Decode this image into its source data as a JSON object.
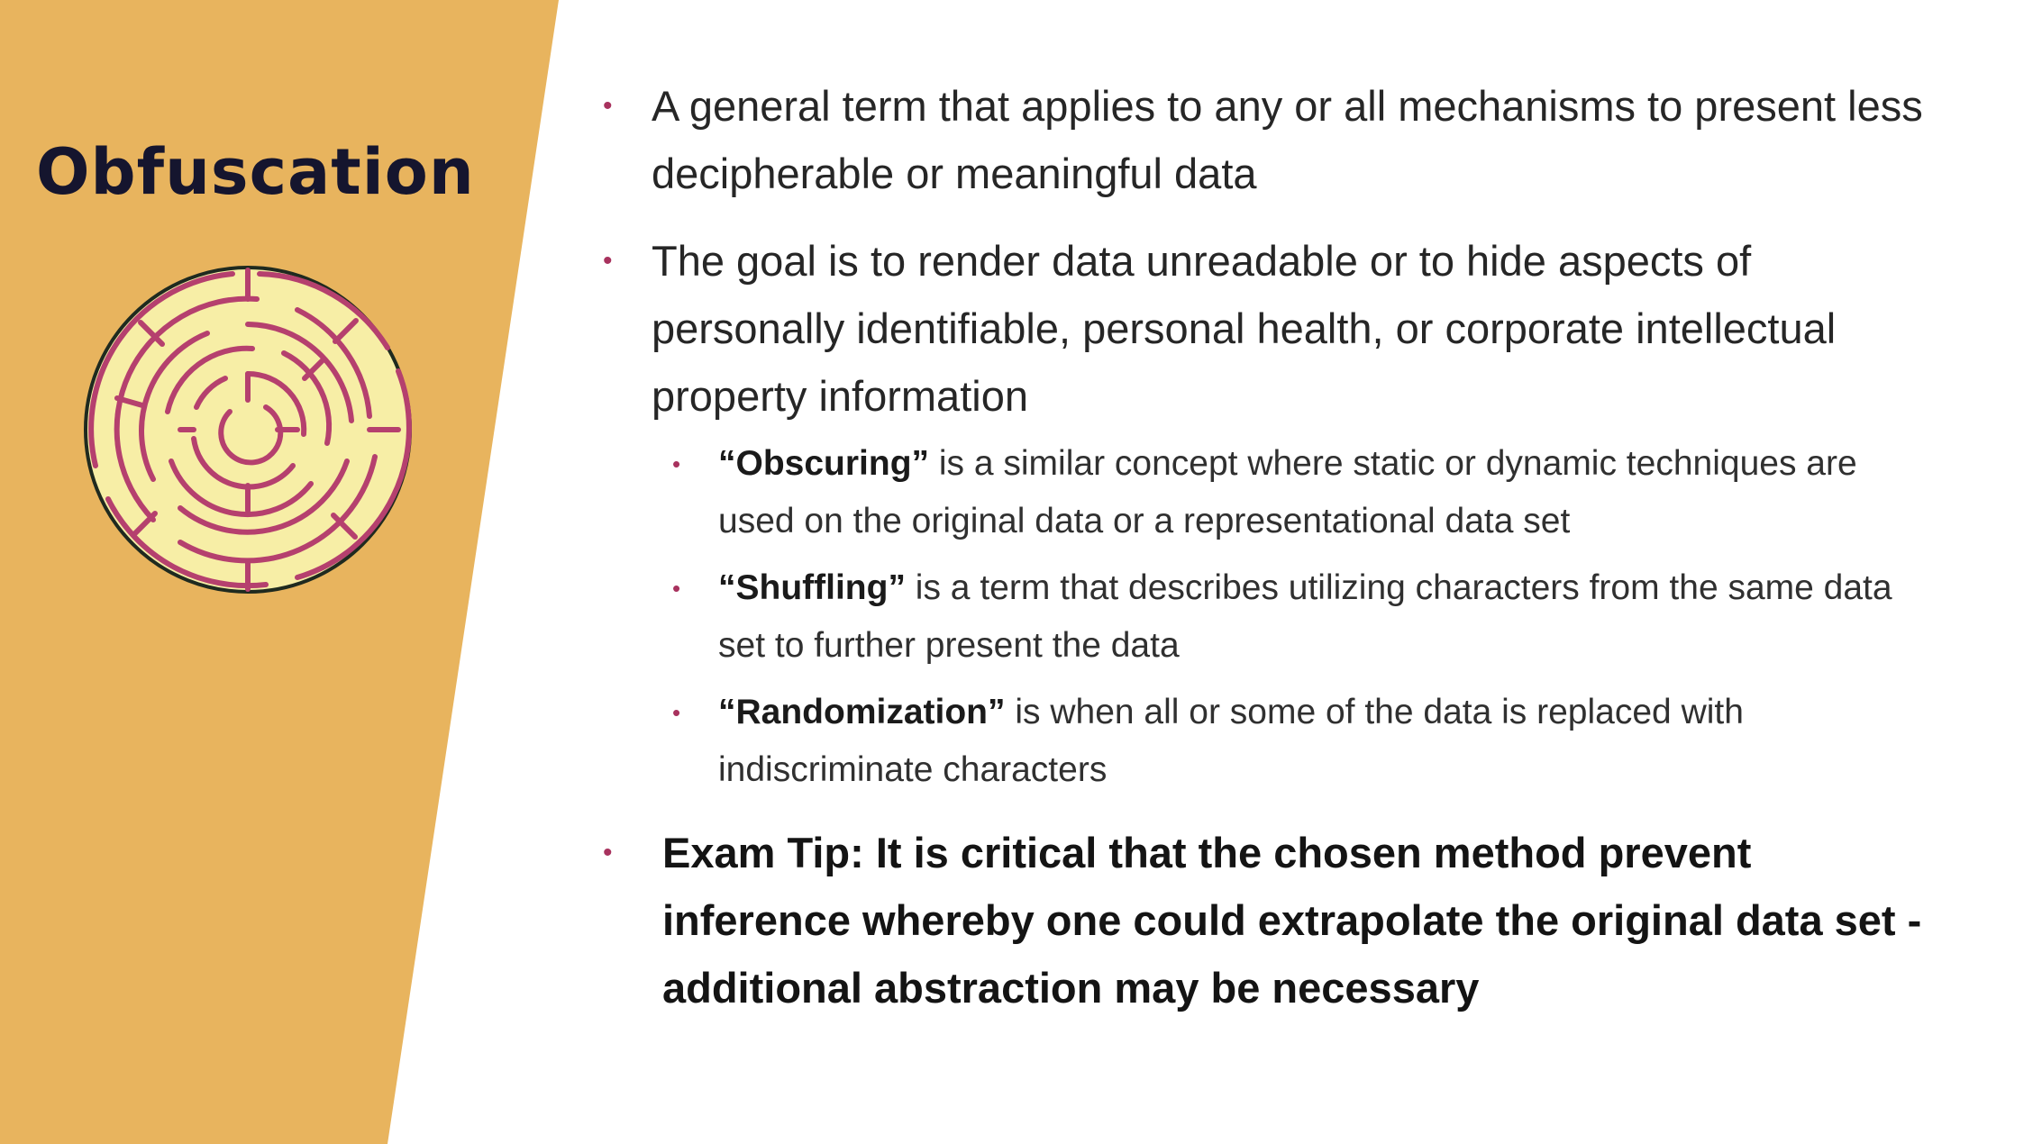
{
  "slide": {
    "title": "Obfuscation",
    "colors": {
      "panel": "#E8B45E",
      "bullet": "#A8325E",
      "maze_fill": "#F7EEA6",
      "maze_lines": "#B5406E"
    },
    "icon": "maze-icon"
  },
  "bullets": [
    {
      "text": "A general term that applies to any or all mechanisms to present less decipherable or meaningful data"
    },
    {
      "text": "The goal is to render data unreadable or to hide aspects of personally identifiable, personal health, or corporate intellectual property information"
    }
  ],
  "sub_bullets": [
    {
      "term": "“Obscuring”",
      "text": " is a similar concept where static or dynamic techniques are used on the original data or a representational data set"
    },
    {
      "term": "“Shuffling”",
      "text": " is a term that describes utilizing characters from the same data set to further present the data"
    },
    {
      "term": "“Randomization”",
      "text": " is when all or some of the data is replaced with indiscriminate characters"
    }
  ],
  "exam_tip": "Exam Tip: It is critical that the chosen method prevent inference whereby one could extrapolate the original data set - additional abstraction may be necessary",
  "bullet_glyph": "•"
}
